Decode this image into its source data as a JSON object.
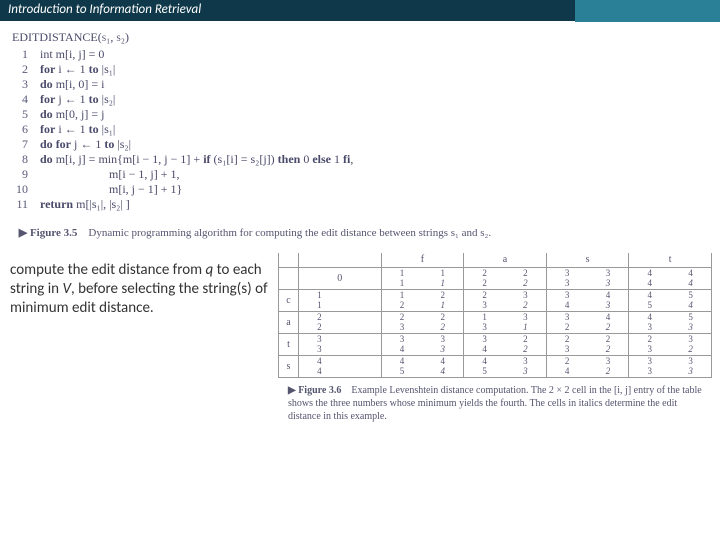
{
  "header": {
    "title": "Introduction to Information Retrieval"
  },
  "algorithm": {
    "title": "EDITDISTANCE(s₁, s₂)",
    "lines": [
      {
        "n": "1",
        "t": "int m[i, j] = 0"
      },
      {
        "n": "2",
        "t": "for i ← 1 to |s₁|"
      },
      {
        "n": "3",
        "t": "do m[i, 0] = i"
      },
      {
        "n": "4",
        "t": "for j ← 1 to |s₂|"
      },
      {
        "n": "5",
        "t": "do m[0, j] = j"
      },
      {
        "n": "6",
        "t": "for i ← 1 to |s₁|"
      },
      {
        "n": "7",
        "t": "do for j ← 1 to |s₂|"
      },
      {
        "n": "8",
        "t": "do m[i, j] = min{m[i − 1, j − 1] + if (s₁[i] = s₂[j]) then 0 else 1 fi,"
      },
      {
        "n": "9",
        "t": "                       m[i − 1, j] + 1,"
      },
      {
        "n": "10",
        "t": "                       m[i, j − 1] + 1}"
      },
      {
        "n": "11",
        "t": "return m[|s₁|, |s₂| ]"
      }
    ]
  },
  "figure35": {
    "label": "▶ Figure 3.5",
    "text": "Dynamic programming algorithm for computing the edit distance between strings s₁ and s₂."
  },
  "note": {
    "l1": "compute the edit distance from ",
    "q": "q",
    "l2": " to each string in ",
    "v": "V",
    "l3": ", before selecting the string(s) of minimum edit distance."
  },
  "table": {
    "col_headers": [
      "",
      "",
      "f",
      "a",
      "s",
      "t"
    ],
    "rows": [
      {
        "h": "",
        "cells": [
          {
            "s": "0"
          },
          {
            "a": "1",
            "b": "1",
            "c": "1",
            "d": "1"
          },
          {
            "a": "2",
            "b": "2",
            "c": "2",
            "d": "2"
          },
          {
            "a": "3",
            "b": "3",
            "c": "3",
            "d": "3"
          },
          {
            "a": "4",
            "b": "4",
            "c": "4",
            "d": "4"
          }
        ]
      },
      {
        "h": "c",
        "cells": [
          {
            "a": "1",
            "b": "",
            "c": "1",
            "d": ""
          },
          {
            "a": "1",
            "b": "2",
            "c": "2",
            "d": "1"
          },
          {
            "a": "2",
            "b": "3",
            "c": "3",
            "d": "2"
          },
          {
            "a": "3",
            "b": "4",
            "c": "4",
            "d": "3"
          },
          {
            "a": "4",
            "b": "5",
            "c": "5",
            "d": "4"
          }
        ]
      },
      {
        "h": "a",
        "cells": [
          {
            "a": "2",
            "b": "",
            "c": "2",
            "d": ""
          },
          {
            "a": "2",
            "b": "2",
            "c": "3",
            "d": "2"
          },
          {
            "a": "1",
            "b": "3",
            "c": "3",
            "d": "1"
          },
          {
            "a": "3",
            "b": "4",
            "c": "2",
            "d": "2"
          },
          {
            "a": "4",
            "b": "5",
            "c": "3",
            "d": "3"
          }
        ]
      },
      {
        "h": "t",
        "cells": [
          {
            "a": "3",
            "b": "",
            "c": "3",
            "d": ""
          },
          {
            "a": "3",
            "b": "3",
            "c": "4",
            "d": "3"
          },
          {
            "a": "3",
            "b": "2",
            "c": "4",
            "d": "2"
          },
          {
            "a": "2",
            "b": "2",
            "c": "3",
            "d": "2"
          },
          {
            "a": "2",
            "b": "3",
            "c": "3",
            "d": "2"
          }
        ]
      },
      {
        "h": "s",
        "cells": [
          {
            "a": "4",
            "b": "",
            "c": "4",
            "d": ""
          },
          {
            "a": "4",
            "b": "4",
            "c": "5",
            "d": "4"
          },
          {
            "a": "4",
            "b": "3",
            "c": "5",
            "d": "3"
          },
          {
            "a": "2",
            "b": "3",
            "c": "4",
            "d": "2"
          },
          {
            "a": "3",
            "b": "3",
            "c": "3",
            "d": "3"
          }
        ]
      }
    ]
  },
  "figure36": {
    "label": "▶ Figure 3.6",
    "text": "Example Levenshtein distance computation. The 2 × 2 cell in the [i, j] entry of the table shows the three numbers whose minimum yields the fourth. The cells in italics determine the edit distance in this example."
  }
}
